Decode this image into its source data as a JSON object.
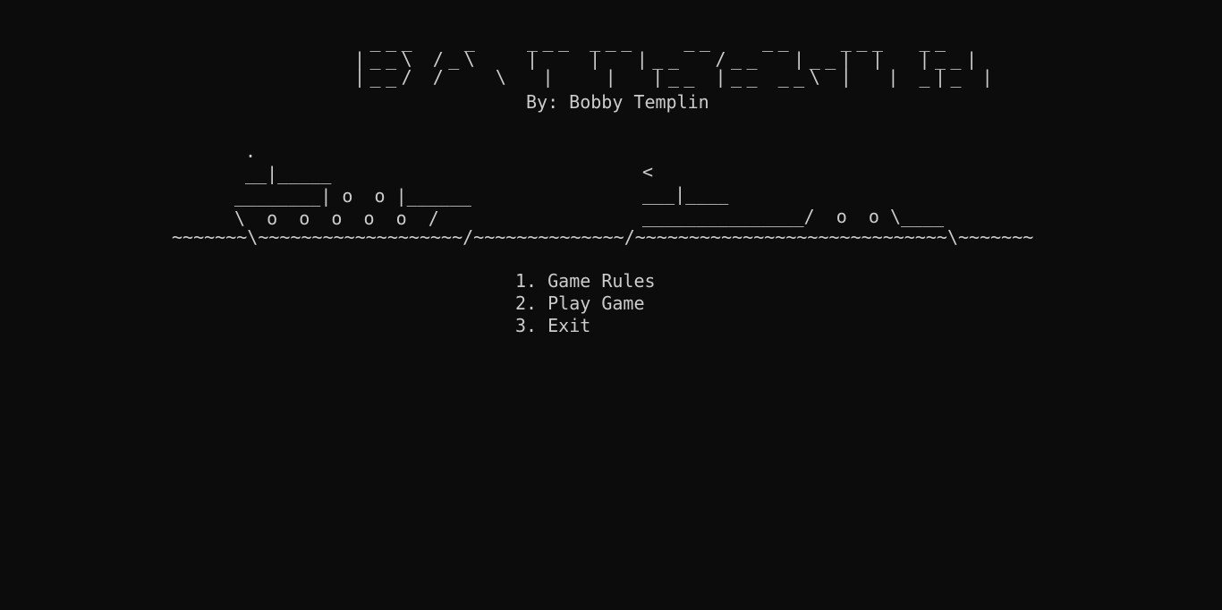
{
  "window": {
    "background": "#0c0c0c",
    "foreground": "#cccccc"
  },
  "title_art": {
    "text": " ___   _   ___ ___   __   __   ___  __\n|__\\ /_\\   |   |  |__  /__  |__| |  |__|\n|__/ /   \\  |   |  |__ |__ __\\ |  | _|_ |"
  },
  "author": "By: Bobby Templin",
  "ships": {
    "left": " .\n __|_____\n________| o  o |______\n\\  o  o  o  o  o  /",
    "right": "<\n___|____\n_______________/  o  o \\____"
  },
  "sea": "~~~~~~~\\~~~~~~~~~~~~~~~~~~~/~~~~~~~~~~~~~~/~~~~~~~~~~~~~~~~~~~~~~~~~~~~~\\~~~~~~~",
  "menu": {
    "items": [
      "1. Game Rules",
      "2. Play Game",
      "3. Exit"
    ]
  }
}
